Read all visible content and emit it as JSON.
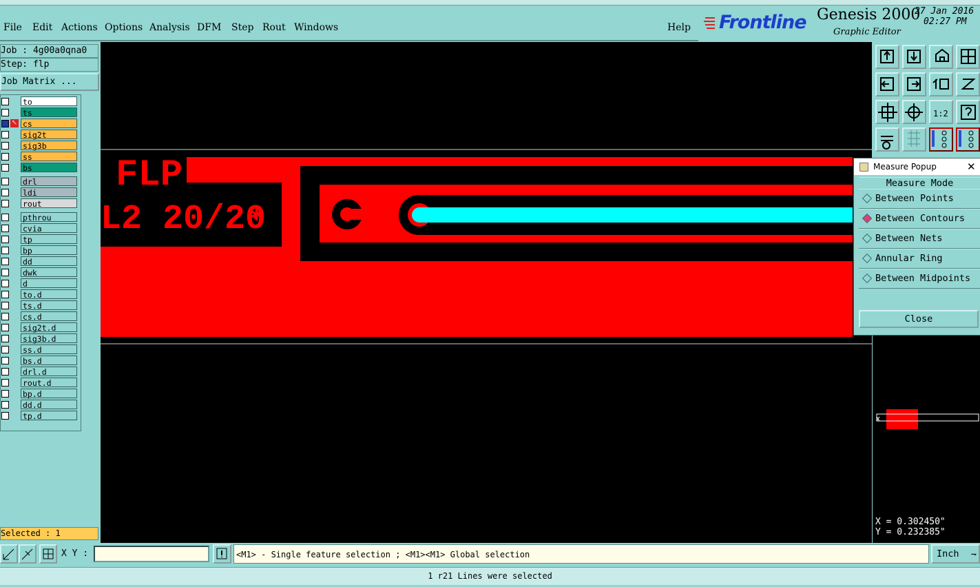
{
  "menu": {
    "items": [
      "File",
      "Edit",
      "Actions",
      "Options",
      "Analysis",
      "DFM",
      "Step",
      "Rout",
      "Windows"
    ],
    "help": "Help"
  },
  "brand": {
    "logo": "Frontline",
    "product": "Genesis 2000",
    "subtitle": "Graphic Editor",
    "date": "27 Jan 2016",
    "time": "02:27 PM"
  },
  "job": {
    "job_line": "Job : 4g00a0qna0",
    "step_line": "Step: flp",
    "matrix_button": "Job Matrix ..."
  },
  "layers": [
    {
      "name": "to",
      "color": "#ffffff"
    },
    {
      "name": "ts",
      "color": "#0a9a7a"
    },
    {
      "name": "cs",
      "color": "#ffbb44"
    },
    {
      "name": "sig2t",
      "color": "#ffbb44"
    },
    {
      "name": "sig3b",
      "color": "#ffbb44"
    },
    {
      "name": "ss",
      "color": "#ffbb44"
    },
    {
      "name": "bs",
      "color": "#0a9a7a"
    },
    {
      "name": "drl",
      "color": "#a7b9bf"
    },
    {
      "name": "ldi",
      "color": "#a7b9bf"
    },
    {
      "name": "rout",
      "color": "#d9d9d9"
    },
    {
      "name": "pthrou",
      "color": "#93d6d2"
    },
    {
      "name": "cvia",
      "color": "#93d6d2"
    },
    {
      "name": "tp",
      "color": "#93d6d2"
    },
    {
      "name": "bp",
      "color": "#93d6d2"
    },
    {
      "name": "dd",
      "color": "#93d6d2"
    },
    {
      "name": "dwk",
      "color": "#93d6d2"
    },
    {
      "name": "d",
      "color": "#93d6d2"
    },
    {
      "name": "to.d",
      "color": "#93d6d2"
    },
    {
      "name": "ts.d",
      "color": "#93d6d2"
    },
    {
      "name": "cs.d",
      "color": "#93d6d2"
    },
    {
      "name": "sig2t.d",
      "color": "#93d6d2"
    },
    {
      "name": "sig3b.d",
      "color": "#93d6d2"
    },
    {
      "name": "ss.d",
      "color": "#93d6d2"
    },
    {
      "name": "bs.d",
      "color": "#93d6d2"
    },
    {
      "name": "drl.d",
      "color": "#93d6d2"
    },
    {
      "name": "rout.d",
      "color": "#93d6d2"
    },
    {
      "name": "bp.d",
      "color": "#93d6d2"
    },
    {
      "name": "dd.d",
      "color": "#93d6d2"
    },
    {
      "name": "tp.d",
      "color": "#93d6d2"
    }
  ],
  "selected_text": "Selected : 1",
  "canvas": {
    "text_line1": "FLP",
    "text_line2": "L2 20/20",
    "copper_color": "#ff0000",
    "trace_color": "#00ffff"
  },
  "popup": {
    "title": "Measure Popup",
    "mode_header": "Measure Mode",
    "modes": [
      "Between Points",
      "Between Contours",
      "Between Nets",
      "Annular Ring",
      "Between Midpoints"
    ],
    "selected_mode": "Between Contours",
    "close_label": "Close"
  },
  "coords": {
    "x": "X = 0.302450\"",
    "y": "Y = 0.232385\""
  },
  "bottom": {
    "xy_label": "X Y :",
    "hint": "<M1> - Single feature selection ; <M1><M1> Global selection",
    "unit": "Inch",
    "status": "1 r21 Lines were selected"
  }
}
